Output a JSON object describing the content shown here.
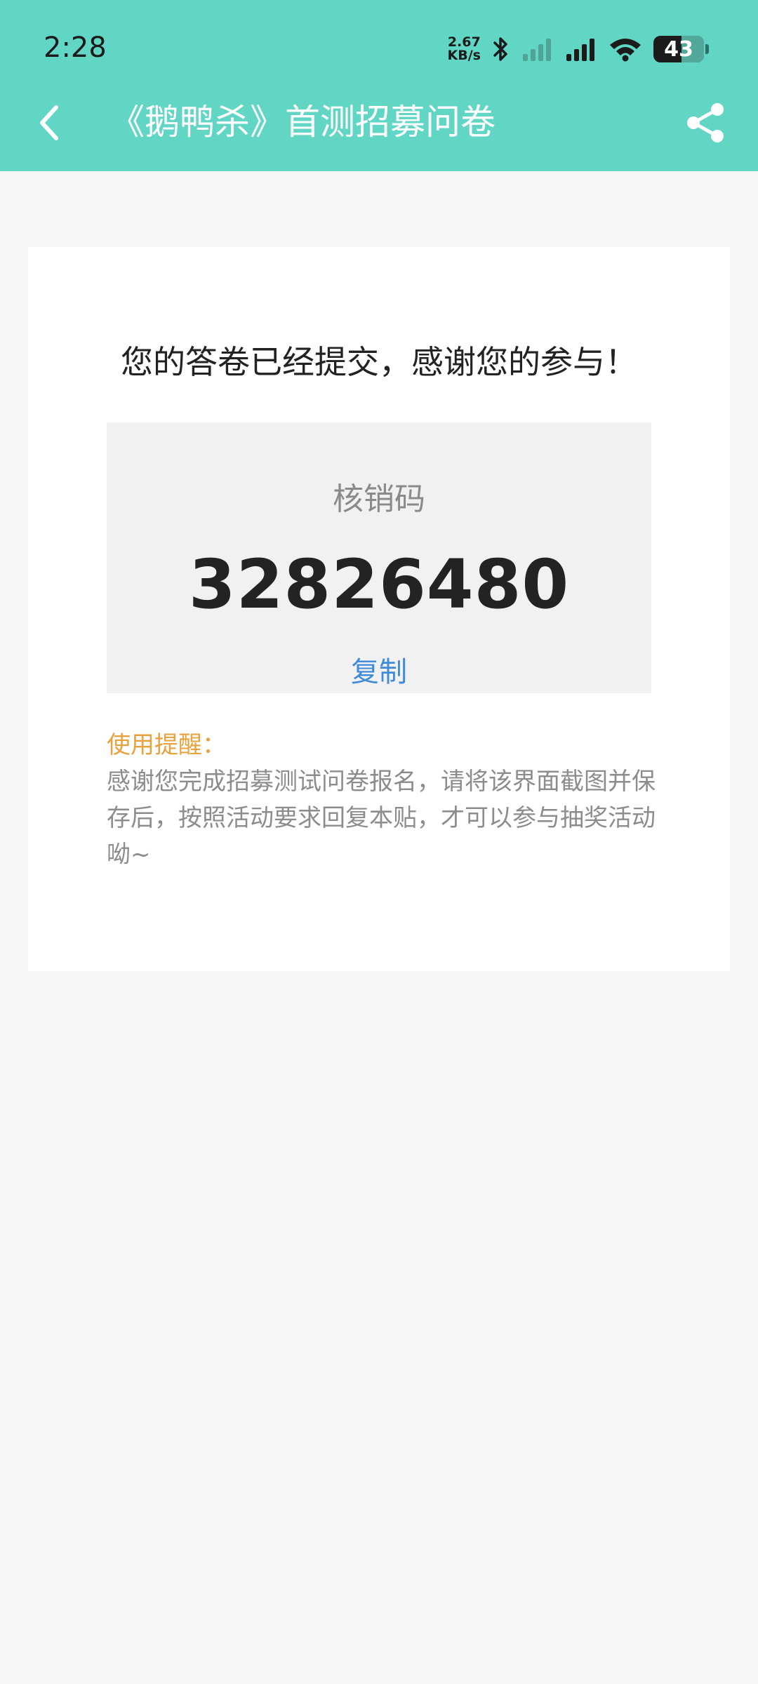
{
  "status_bar": {
    "time": "2:28",
    "net_speed_value": "2.67",
    "net_speed_unit": "KB/s",
    "battery_level": "43",
    "icons": [
      "bluetooth-icon",
      "signal-weak-icon",
      "signal-icon",
      "wifi-icon",
      "battery-icon"
    ]
  },
  "header": {
    "title": "《鹅鸭杀》首测招募问卷",
    "back_icon": "back-arrow-icon",
    "share_icon": "share-icon",
    "background_color": "#62d6c4"
  },
  "result": {
    "message": "您的答卷已经提交，感谢您的参与！",
    "code_label": "核销码",
    "code_value": "32826480",
    "copy_label": "复制"
  },
  "reminder": {
    "title": "使用提醒：",
    "body": "感谢您完成招募测试问卷报名，请将该界面截图并保存后，按照活动要求回复本贴，才可以参与抽奖活动呦~",
    "title_color": "#e7a23d"
  }
}
